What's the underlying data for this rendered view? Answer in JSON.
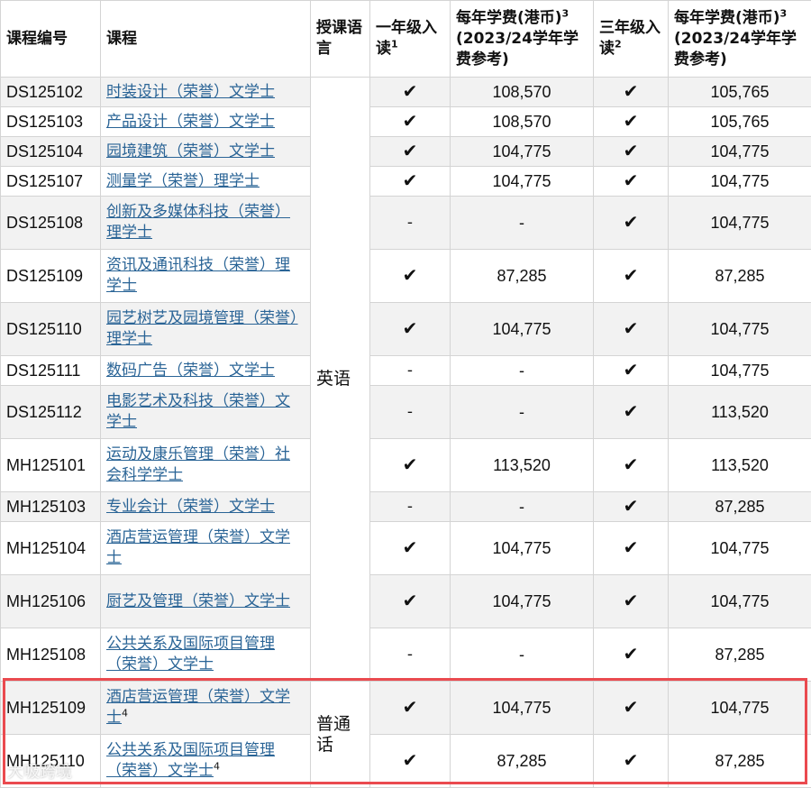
{
  "headers": {
    "code": "课程编号",
    "course": "课程",
    "language": "授课语言",
    "year1": "一年级入读",
    "year1_sup": "1",
    "fee1": "每年学费(港币)",
    "fee1_sup": "3",
    "fee1_note": "(2023/24学年学费参考)",
    "year3": "三年级入读",
    "year3_sup": "2",
    "fee3": "每年学费(港币)",
    "fee3_sup": "3",
    "fee3_note": "(2023/24学年学费参考)"
  },
  "languages": {
    "english": "英语",
    "mandarin": "普通话"
  },
  "check_mark": "✔",
  "dash": "-",
  "rows": [
    {
      "code": "DS125102",
      "course": "时装设计（荣誉）文学士",
      "sup": "",
      "y1": "✔",
      "fee1": "108,570",
      "y3": "✔",
      "fee3": "105,765"
    },
    {
      "code": "DS125103",
      "course": "产品设计（荣誉）文学士",
      "sup": "",
      "y1": "✔",
      "fee1": "108,570",
      "y3": "✔",
      "fee3": "105,765"
    },
    {
      "code": "DS125104",
      "course": "园境建筑（荣誉）文学士",
      "sup": "",
      "y1": "✔",
      "fee1": "104,775",
      "y3": "✔",
      "fee3": "104,775"
    },
    {
      "code": "DS125107",
      "course": "测量学（荣誉）理学士",
      "sup": "",
      "y1": "✔",
      "fee1": "104,775",
      "y3": "✔",
      "fee3": "104,775"
    },
    {
      "code": "DS125108",
      "course": "创新及多媒体科技（荣誉）理学士",
      "sup": "",
      "y1": "-",
      "fee1": "-",
      "y3": "✔",
      "fee3": "104,775"
    },
    {
      "code": "DS125109",
      "course": "资讯及通讯科技（荣誉）理学士",
      "sup": "",
      "y1": "✔",
      "fee1": "87,285",
      "y3": "✔",
      "fee3": "87,285"
    },
    {
      "code": "DS125110",
      "course": "园艺树艺及园境管理（荣誉）理学士",
      "sup": "",
      "y1": "✔",
      "fee1": "104,775",
      "y3": "✔",
      "fee3": "104,775"
    },
    {
      "code": "DS125111",
      "course": "数码广告（荣誉）文学士",
      "sup": "",
      "y1": "-",
      "fee1": "-",
      "y3": "✔",
      "fee3": "104,775"
    },
    {
      "code": "DS125112",
      "course": "电影艺术及科技（荣誉）文学士",
      "sup": "",
      "y1": "-",
      "fee1": "-",
      "y3": "✔",
      "fee3": "113,520"
    },
    {
      "code": "MH125101",
      "course": "运动及康乐管理（荣誉）社会科学学士",
      "sup": "",
      "y1": "✔",
      "fee1": "113,520",
      "y3": "✔",
      "fee3": "113,520"
    },
    {
      "code": "MH125103",
      "course": "专业会计（荣誉）文学士",
      "sup": "",
      "y1": "-",
      "fee1": "-",
      "y3": "✔",
      "fee3": "87,285"
    },
    {
      "code": "MH125104",
      "course": "酒店营运管理（荣誉）文学士",
      "sup": "",
      "y1": "✔",
      "fee1": "104,775",
      "y3": "✔",
      "fee3": "104,775"
    },
    {
      "code": "MH125106",
      "course": "厨艺及管理（荣誉）文学士",
      "sup": "",
      "y1": "✔",
      "fee1": "104,775",
      "y3": "✔",
      "fee3": "104,775"
    },
    {
      "code": "MH125108",
      "course": "公共关系及国际项目管理（荣誉）文学士",
      "sup": "",
      "y1": "-",
      "fee1": "-",
      "y3": "✔",
      "fee3": "87,285"
    },
    {
      "code": "MH125109",
      "course": "酒店营运管理（荣誉）文学士",
      "sup": "4",
      "y1": "✔",
      "fee1": "104,775",
      "y3": "✔",
      "fee3": "104,775"
    },
    {
      "code": "MH125110",
      "course": "公共关系及国际项目管理（荣誉）文学士",
      "sup": "4",
      "y1": "✔",
      "fee1": "87,285",
      "y3": "✔",
      "fee3": "87,285"
    }
  ],
  "watermark": "大吸跨境",
  "colors": {
    "link": "#2a6496",
    "highlight": "#ea4a4f",
    "zebra": "#f2f2f2",
    "border": "#d4d4d4"
  }
}
